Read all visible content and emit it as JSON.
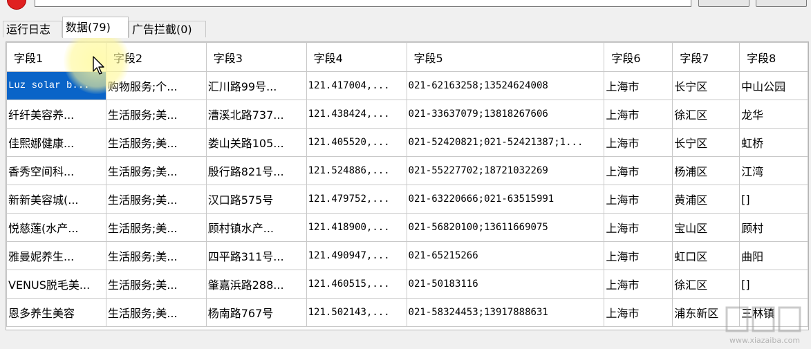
{
  "tabs": [
    {
      "label": "运行日志",
      "active": false
    },
    {
      "label": "数据(79)",
      "active": true
    },
    {
      "label": "广告拦截(0)",
      "active": false
    }
  ],
  "table": {
    "headers": [
      "字段1",
      "字段2",
      "字段3",
      "字段4",
      "字段5",
      "字段6",
      "字段7",
      "字段8"
    ],
    "rows": [
      [
        "Luz solar b...",
        "购物服务;个...",
        "汇川路99号...",
        "121.417004,...",
        "021-62163258;13524624008",
        "上海市",
        "长宁区",
        "中山公园"
      ],
      [
        "纤纤美容养...",
        "生活服务;美...",
        "漕溪北路737...",
        "121.438424,...",
        "021-33637079;13818267606",
        "上海市",
        "徐汇区",
        "龙华"
      ],
      [
        "佳熙娜健康...",
        "生活服务;美...",
        "娄山关路105...",
        "121.405520,...",
        "021-52420821;021-52421387;1...",
        "上海市",
        "长宁区",
        "虹桥"
      ],
      [
        "香秀空间科...",
        "生活服务;美...",
        "殷行路821号...",
        "121.524886,...",
        "021-55227702;18721032269",
        "上海市",
        "杨浦区",
        "江湾"
      ],
      [
        "新新美容城(...",
        "生活服务;美...",
        "汉口路575号",
        "121.479752,...",
        "021-63220666;021-63515991",
        "上海市",
        "黄浦区",
        "[]"
      ],
      [
        "悦慈莲(水产...",
        "生活服务;美...",
        "顾村镇水产...",
        "121.418900,...",
        "021-56820100;13611669075",
        "上海市",
        "宝山区",
        "顾村"
      ],
      [
        "雅曼妮养生...",
        "生活服务;美...",
        "四平路311号...",
        "121.490947,...",
        "021-65215266",
        "上海市",
        "虹口区",
        "曲阳"
      ],
      [
        "VENUS脱毛美...",
        "生活服务;美...",
        "肇嘉浜路288...",
        "121.460515,...",
        "021-50183116",
        "上海市",
        "徐汇区",
        "[]"
      ],
      [
        "恩多养生美容",
        "生活服务;美...",
        "杨南路767号",
        "121.502143,...",
        "021-58324453;13917888631",
        "上海市",
        "浦东新区",
        "三林镇"
      ]
    ]
  },
  "selection": {
    "row": 0,
    "col": 0,
    "color": "#0a64c8"
  },
  "colors": {
    "record_button": "#e02020",
    "grid_border": "#c9c9c9"
  },
  "watermark": {
    "url": "www.xiazaiba.com"
  }
}
